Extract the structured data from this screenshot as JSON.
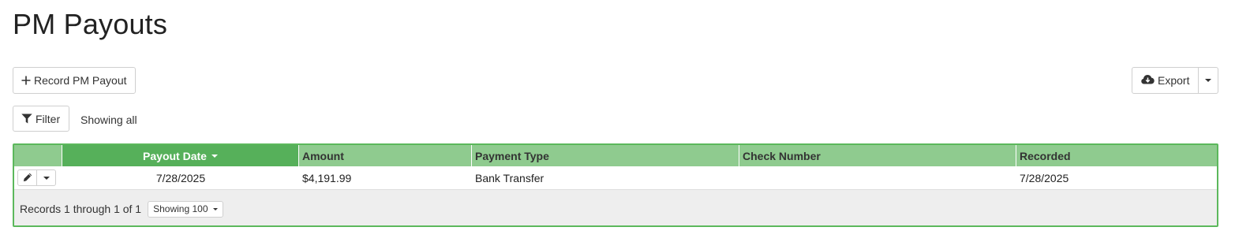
{
  "page": {
    "title": "PM Payouts"
  },
  "toolbar": {
    "record_label": "Record PM Payout",
    "export_label": "Export",
    "filter_label": "Filter",
    "filter_status": "Showing all"
  },
  "icons": {
    "record": "plus-icon",
    "export": "cloud-download-icon",
    "filter": "funnel-icon",
    "edit": "pencil-icon",
    "dropdown": "caret-down-icon"
  },
  "colors": {
    "header_bg": "#8fcb8f",
    "sorted_header_bg": "#56b05a",
    "grid_border": "#5cb85c",
    "footer_bg": "#eeeeee"
  },
  "table": {
    "columns": [
      {
        "label": "",
        "key": "actions"
      },
      {
        "label": "Payout Date",
        "key": "payout_date",
        "sorted": "desc"
      },
      {
        "label": "Amount",
        "key": "amount"
      },
      {
        "label": "Payment Type",
        "key": "payment_type"
      },
      {
        "label": "Check Number",
        "key": "check_number"
      },
      {
        "label": "Recorded",
        "key": "recorded"
      }
    ],
    "rows": [
      {
        "payout_date": "7/28/2025",
        "amount": "$4,191.99",
        "payment_type": "Bank Transfer",
        "check_number": "",
        "recorded": "7/28/2025"
      }
    ],
    "footer": {
      "records_text": "Records 1 through 1 of 1",
      "page_size_label": "Showing 100"
    }
  }
}
